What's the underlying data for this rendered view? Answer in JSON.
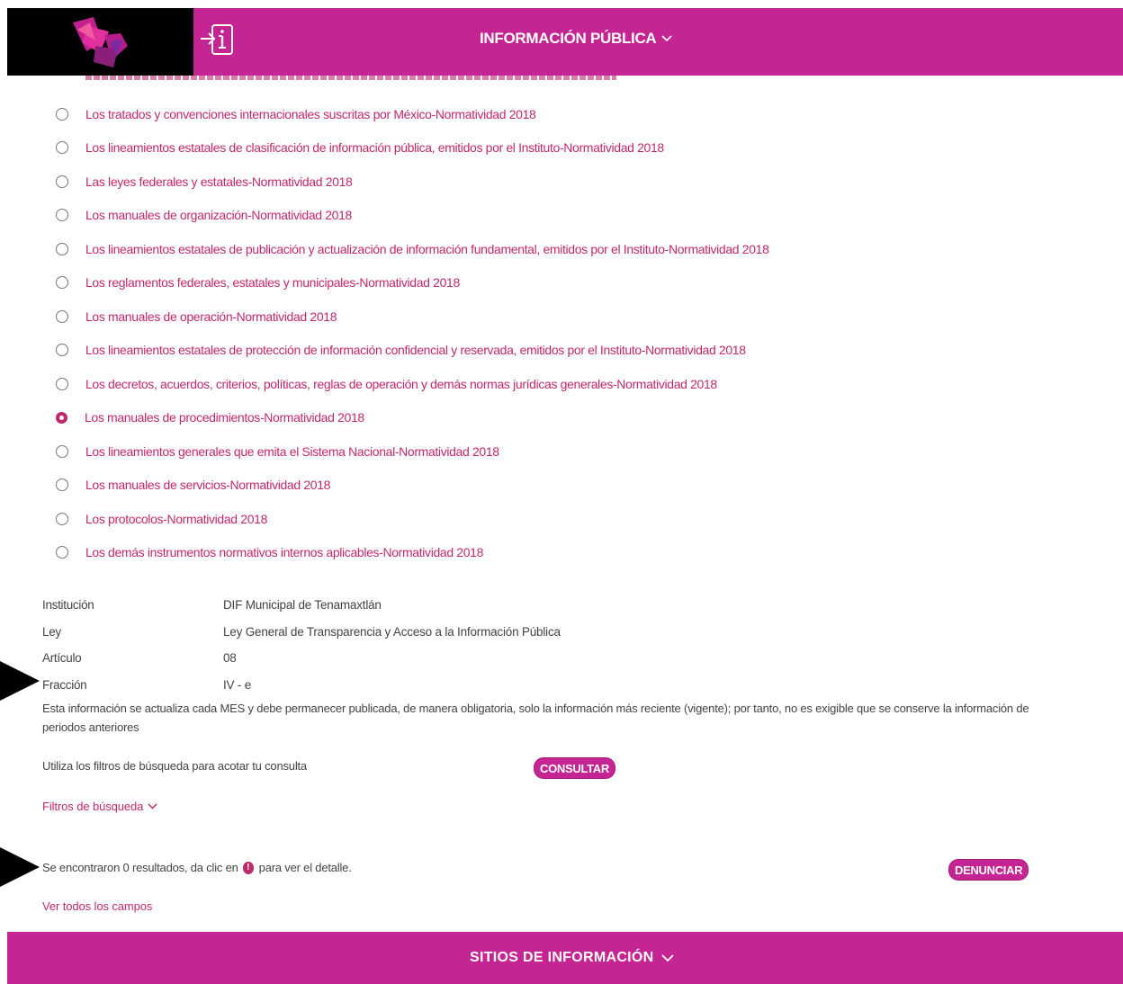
{
  "header": {
    "title": "INFORMACIÓN PÚBLICA",
    "logo_icon": "logo-icon",
    "login_icon": "login-info-icon",
    "brand_color": "#c42592"
  },
  "radio_items": [
    {
      "label": "Los tratados y convenciones internacionales suscritas por México-Normatividad 2018",
      "checked": false
    },
    {
      "label": "Los lineamientos estatales de clasificación de información pública, emitidos por el Instituto-Normatividad 2018",
      "checked": false
    },
    {
      "label": "Las leyes federales y estatales-Normatividad 2018",
      "checked": false
    },
    {
      "label": "Los manuales de organización-Normatividad 2018",
      "checked": false
    },
    {
      "label": "Los lineamientos estatales de publicación y actualización de información fundamental, emitidos por el Instituto-Normatividad 2018",
      "checked": false
    },
    {
      "label": "Los reglamentos federales, estatales y municipales-Normatividad 2018",
      "checked": false
    },
    {
      "label": "Los manuales de operación-Normatividad 2018",
      "checked": false
    },
    {
      "label": "Los lineamientos estatales de protección de información confidencial y reservada, emitidos por el Instituto-Normatividad 2018",
      "checked": false
    },
    {
      "label": "Los decretos, acuerdos, criterios, políticas, reglas de operación y demás normas jurídicas generales-Normatividad 2018",
      "checked": false
    },
    {
      "label": "Los manuales de procedimientos-Normatividad 2018",
      "checked": true
    },
    {
      "label": "Los lineamientos generales que emita el Sistema Nacional-Normatividad 2018",
      "checked": false
    },
    {
      "label": "Los manuales de servicios-Normatividad 2018",
      "checked": false
    },
    {
      "label": "Los protocolos-Normatividad 2018",
      "checked": false
    },
    {
      "label": "Los demás instrumentos normativos internos aplicables-Normatividad 2018",
      "checked": false
    }
  ],
  "info": {
    "institucion_label": "Institución",
    "institucion_value": "DIF Municipal de Tenamaxtlán",
    "ley_label": "Ley",
    "ley_value": "Ley General de Transparencia y Acceso a la Información Pública",
    "articulo_label": "Artículo",
    "articulo_value": "08",
    "fraccion_label": "Fracción",
    "fraccion_value": "IV - e",
    "notice": "Esta información se actualiza cada MES y debe permanecer publicada, de manera obligatoria, solo la información más reciente (vigente); por tanto, no es exigible que se conserve la información de periodos anteriores"
  },
  "search": {
    "filters_hint": "Utiliza los filtros de búsqueda para acotar tu consulta",
    "consultar_label": "CONSULTAR",
    "filtros_label": "Filtros de búsqueda"
  },
  "results": {
    "text_before": "Se encontraron 0 resultados, da clic en",
    "text_after": "para ver el detalle.",
    "denunciar_label": "DENUNCIAR",
    "ver_todos_label": "Ver todos los campos"
  },
  "footer": {
    "title": "SITIOS DE INFORMACIÓN"
  }
}
